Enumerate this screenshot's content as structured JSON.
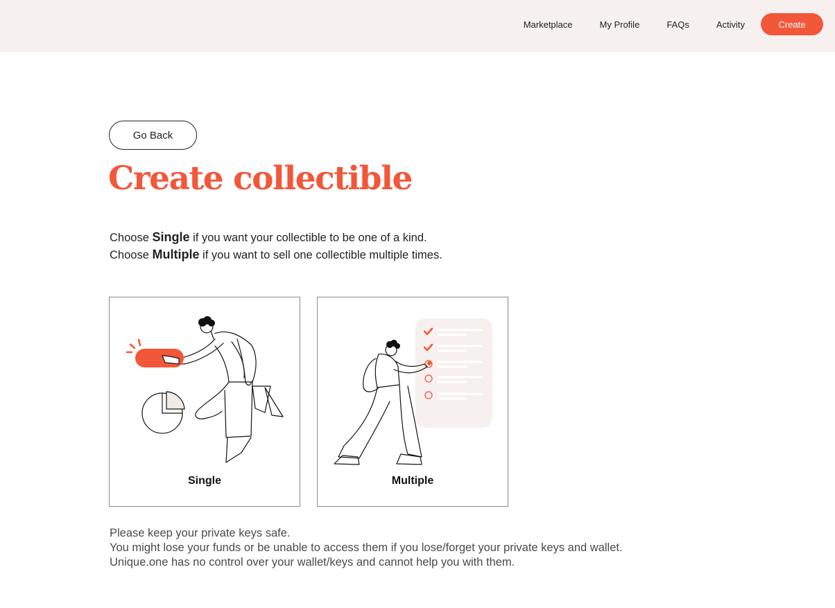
{
  "nav": {
    "items": [
      "Marketplace",
      "My Profile",
      "FAQs",
      "Activity"
    ],
    "create_label": "Create"
  },
  "go_back_label": "Go Back",
  "page_title": "Create collectible",
  "intro": {
    "line1_prefix": "Choose ",
    "line1_bold": "Single",
    "line1_suffix": " if you want your collectible to be one of a kind.",
    "line2_prefix": "Choose ",
    "line2_bold": "Multiple",
    "line2_suffix": " if you want to sell one collectible multiple times."
  },
  "options": [
    {
      "label": "Single",
      "illustration": "person-pressing-button-illustration"
    },
    {
      "label": "Multiple",
      "illustration": "person-checklist-illustration"
    }
  ],
  "notice": {
    "line1": "Please keep your private keys safe.",
    "line2": "You might lose your funds or be unable to access them if you lose/forget your private keys and wallet.",
    "line3": "Unique.one has no control over your wallet/keys and cannot help you with them."
  },
  "colors": {
    "accent": "#f2573a",
    "header_bg": "#f6f1ef",
    "panel_bg": "#f6f0ee"
  }
}
